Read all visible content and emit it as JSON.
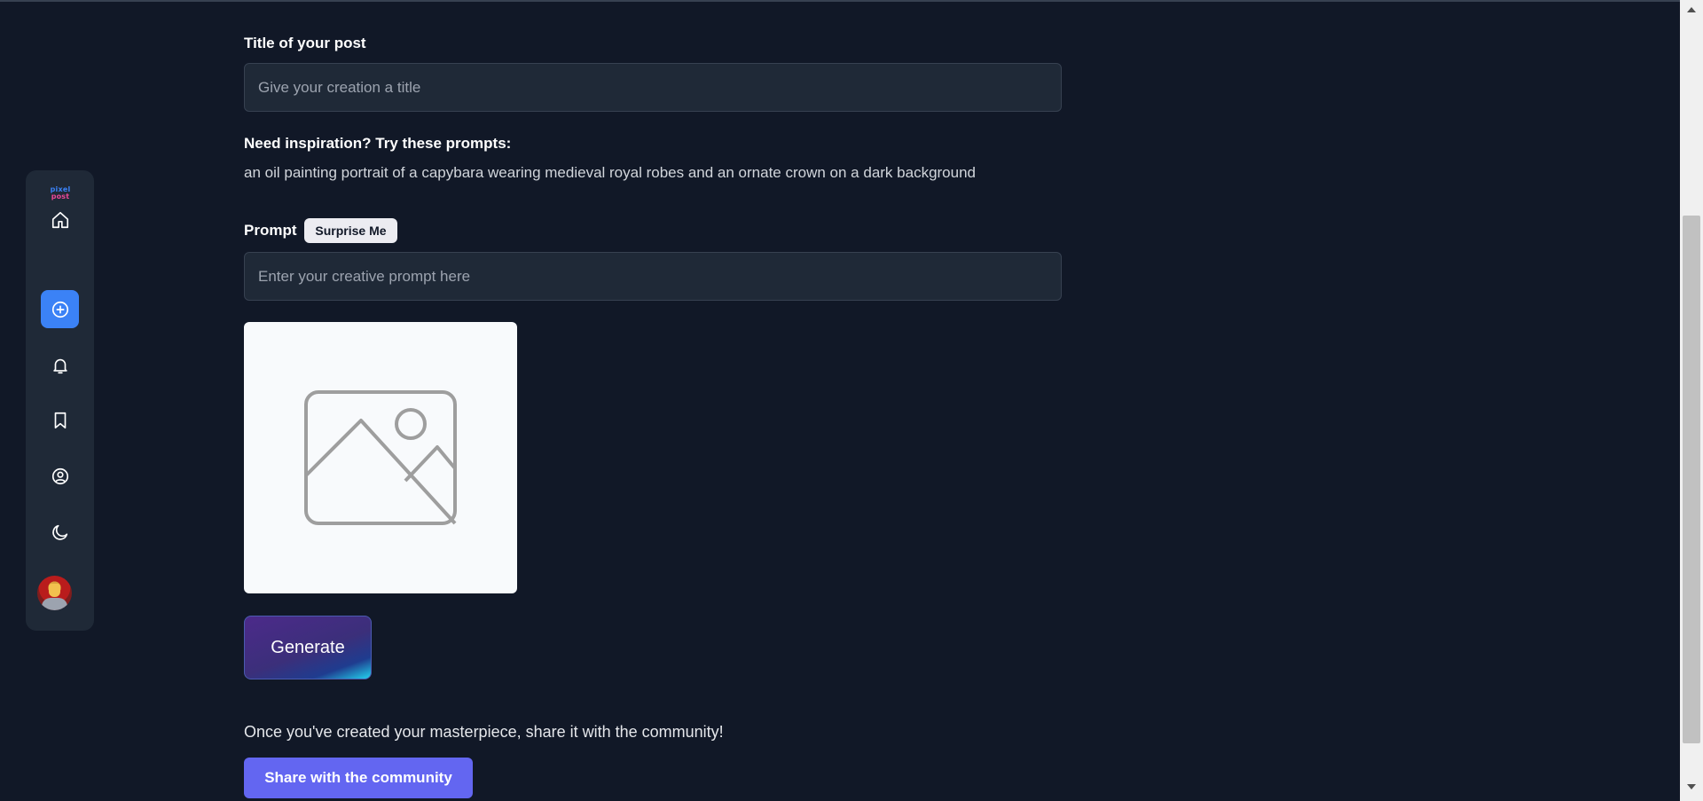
{
  "app": {
    "logo_line1": "pixel",
    "logo_line2": "post"
  },
  "sidebar": {
    "items": [
      {
        "name": "home",
        "icon": "home-icon"
      },
      {
        "name": "create",
        "icon": "plus-circle-icon",
        "active": true
      },
      {
        "name": "notifications",
        "icon": "bell-icon"
      },
      {
        "name": "saved",
        "icon": "bookmark-icon"
      },
      {
        "name": "profile",
        "icon": "user-circle-icon"
      },
      {
        "name": "theme",
        "icon": "moon-icon"
      }
    ],
    "avatar": "avatar"
  },
  "form": {
    "title_label": "Title of your post",
    "title_placeholder": "Give your creation a title",
    "inspiration_label": "Need inspiration? Try these prompts:",
    "inspiration_prompt": "an oil painting portrait of a capybara wearing medieval royal robes and an ornate crown on a dark background",
    "prompt_label": "Prompt",
    "surprise_label": "Surprise Me",
    "prompt_placeholder": "Enter your creative prompt here",
    "image_placeholder_icon": "image-placeholder-icon",
    "generate_label": "Generate",
    "share_text": "Once you've created your masterpiece, share it with the community!",
    "share_label": "Share with the community"
  },
  "colors": {
    "background": "#111827",
    "panel": "#1f2937",
    "accent": "#3b82f6",
    "share_button": "#6366f1"
  }
}
